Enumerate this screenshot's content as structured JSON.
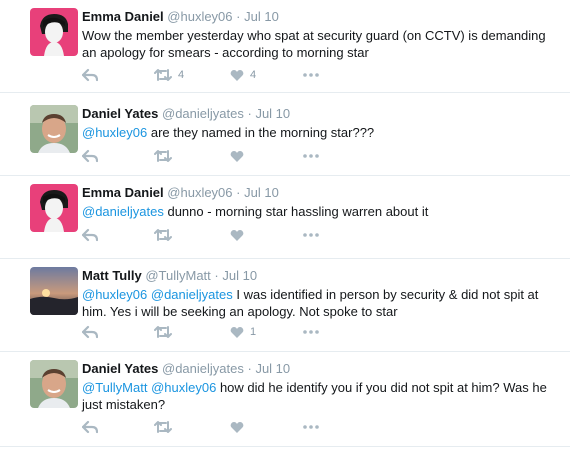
{
  "tweets": [
    {
      "name": "Emma Daniel",
      "handle": "@huxley06",
      "dot": "·",
      "time": "Jul 10",
      "text": [
        "Wow the member yesterday who spat at security guard (on CCTV) is demanding",
        "an apology for smears - according to morning star"
      ],
      "retweets": "4",
      "likes": "4",
      "avatar": "emma-daniel-avatar"
    },
    {
      "name": "Daniel Yates",
      "handle": "@danieljyates",
      "dot": "·",
      "time": "Jul 10",
      "mention1": "@huxley06",
      "text_rest": " are they named in the morning star???",
      "retweets": "",
      "likes": "",
      "avatar": "daniel-yates-avatar"
    },
    {
      "name": "Emma Daniel",
      "handle": "@huxley06",
      "dot": "·",
      "time": "Jul 10",
      "mention1": "@danieljyates",
      "text_rest": " dunno - morning star hassling warren about it",
      "retweets": "",
      "likes": "",
      "avatar": "emma-daniel-avatar"
    },
    {
      "name": "Matt Tully",
      "handle": "@TullyMatt",
      "dot": "·",
      "time": "Jul 10",
      "mention1": "@huxley06",
      "mention2": "@danieljyates",
      "text_rest": " I was identified in person by security & did not spit at",
      "text_line2": "him. Yes i will be seeking an apology. Not spoke to star",
      "retweets": "",
      "likes": "1",
      "avatar": "matt-tully-avatar"
    },
    {
      "name": "Daniel Yates",
      "handle": "@danieljyates",
      "dot": "·",
      "time": "Jul 10",
      "mention1": "@TullyMatt",
      "mention2": "@huxley06",
      "text_rest": " how did he identify you if you did not spit at him? Was he",
      "text_line2": "just mistaken?",
      "retweets": "",
      "likes": "",
      "avatar": "daniel-yates-avatar"
    }
  ],
  "colors": {
    "link": "#1b95e0",
    "meta": "#8899a6",
    "icon": "#aab8c2",
    "divider": "#e6ecf0",
    "emma_bg": "#e8407a"
  },
  "icons": [
    "reply-icon",
    "retweet-icon",
    "like-icon",
    "more-icon"
  ]
}
